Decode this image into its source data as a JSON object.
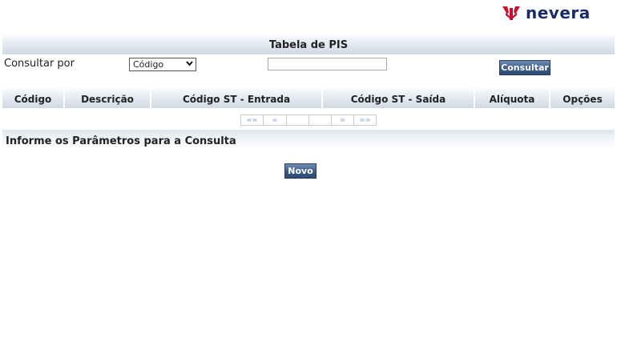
{
  "logo": {
    "text": "nevera",
    "brand_color": "#c8102e",
    "text_color": "#1a2b6b"
  },
  "title": "Tabela de PIS",
  "search": {
    "label": "Consultar por",
    "select_value": "Código",
    "input_value": "",
    "button_label": "Consultar"
  },
  "table": {
    "columns": [
      "Código",
      "Descrição",
      "Código ST - Entrada",
      "Código ST - Saída",
      "Alíquota",
      "Opções"
    ]
  },
  "pager": {
    "first": "««",
    "prev": "«",
    "next": "»",
    "last": "»»"
  },
  "message": "Informe os Parâmetros para a Consulta",
  "new_button_label": "Novo"
}
